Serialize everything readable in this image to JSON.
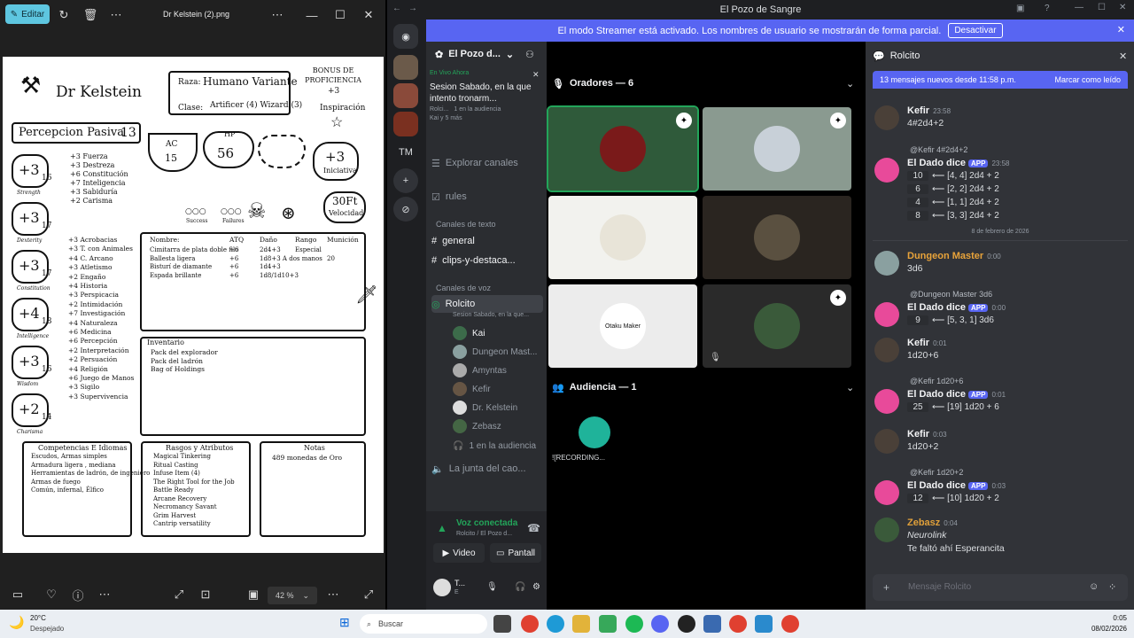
{
  "photos": {
    "edit_label": "Editar",
    "filename": "Dr Kelstein (2).png",
    "zoom": "42 %"
  },
  "sheet": {
    "name": "Dr Kelstein",
    "race_label": "Raza:",
    "race": "Humano Variante",
    "class_label": "Clase:",
    "class": "Artificer (4) Wizard (3)",
    "bonus_label": "BONUS DE PROFICIENCIA",
    "bonus": "+3",
    "inspiration": "Inspiración",
    "passive_label": "Percepcion Pasiva",
    "passive": "13",
    "ac_label": "AC",
    "ac": "15",
    "hp_label": "HP",
    "hp": "56",
    "init": "+3",
    "init_label": "Iniciativa",
    "speed": "30Ft",
    "speed_label": "Velocidad",
    "success": "Success",
    "failures": "Failures",
    "abilities": [
      {
        "mod": "+3",
        "score": "16",
        "name": "Strength"
      },
      {
        "mod": "+3",
        "score": "17",
        "name": "Dexterity"
      },
      {
        "mod": "+3",
        "score": "17",
        "name": "Constitution"
      },
      {
        "mod": "+4",
        "score": "18",
        "name": "Intelligence"
      },
      {
        "mod": "+3",
        "score": "16",
        "name": "Wisdom"
      },
      {
        "mod": "+2",
        "score": "14",
        "name": "Charisma"
      }
    ],
    "saves": [
      "+3 Fuerza",
      "+3 Destreza",
      "+6 Constitución",
      "+7 Inteligencia",
      "+3 Sabiduría",
      "+2 Carisma"
    ],
    "skills": [
      "+3 Acrobacias",
      "+3 T. con Animales",
      "+4 C. Arcano",
      "+3 Atletismo",
      "+2 Engaño",
      "+4 Historia",
      "+3 Perspicacia",
      "+2 Intimidación",
      "+7 Investigación",
      "+4 Naturaleza",
      "+6 Medicina",
      "+6 Percepción",
      "+2 Interpretación",
      "+2 Persuación",
      "+4 Religión",
      "+6 Juego de Manos",
      "+3 Sigilo",
      "+3 Supervivencia"
    ],
    "attack_headers": [
      "Nombre:",
      "ATQ",
      "Daño",
      "Rango",
      "Munición"
    ],
    "attacks": [
      [
        "Cimitarra de plata doble filo",
        "+6",
        "2d4+3",
        "Especial",
        ""
      ],
      [
        "Ballesta ligera",
        "+6",
        "1d8+3 A dos manos",
        "",
        "20"
      ],
      [
        "Bisturí de diamante",
        "+6",
        "1d4+3",
        "",
        ""
      ],
      [
        "Espada brillante",
        "+6",
        "1d8/1d10+3",
        "",
        ""
      ]
    ],
    "inventory_label": "Inventario",
    "inventory": [
      "Pack del explorador",
      "Pack del ladrón",
      "Bag of Holdings"
    ],
    "prof_title": "Competencias E Idiomas",
    "prof": [
      "Escudos, Armas simples",
      "Armadura ligera , mediana",
      "Herramientas de ladrón, de ingeniero",
      "Armas de fuego",
      "Común, infernal, Élfico"
    ],
    "traits_title": "Rasgos y Atributos",
    "traits": [
      "Magical Tinkering",
      "Ritual Casting",
      "Infuse Item (4)",
      "The Right Tool for the Job",
      "Battle Ready",
      "Arcane Recovery",
      "Necromancy Savant",
      "Grim Harvest",
      "Cantrip versatility"
    ],
    "notes_title": "Notas",
    "notes": [
      "489 monedas de Oro"
    ]
  },
  "discord": {
    "title": "El Pozo de Sangre",
    "banner": "El modo Streamer está activado. Los nombres de usuario se mostrarán de forma parcial.",
    "banner_btn": "Desactivar",
    "guild_initials": "TM",
    "server": "El Pozo d...",
    "live_label": "En Vivo Ahora",
    "live_title": "Sesion Sabado, en la que intento tronarm...",
    "live_host": "Rolci...",
    "live_aud": "1 en la audiencia",
    "live_people": "Kai y 5 más",
    "explore": "Explorar canales",
    "rules": "rules",
    "text_cat": "Canales de texto",
    "text_channels": [
      "general",
      "clips-y-destaca..."
    ],
    "voice_cat": "Canales de voz",
    "voice_channel": "Rolcito",
    "voice_sub": "Sesion Sabado, en la que...",
    "voice_users": [
      "Kai",
      "Dungeon Mast...",
      "Amyntas",
      "Kefir",
      "Dr. Kelstein",
      "Zebasz"
    ],
    "voice_aud": "1 en la audiencia",
    "other_channel": "La junta del cao...",
    "conn_label": "Voz conectada",
    "conn_sub": "Rolcito / El Pozo d...",
    "video": "Video",
    "screen": "Pantall",
    "user_short": "T...",
    "user_sub": "E",
    "speakers": "Oradores — 6",
    "audience": "Audiencia — 1",
    "recording": "![RECORDING...",
    "tile_text": "Otaku Maker",
    "chat_title": "Rolcito",
    "new_msgs": "13 mensajes nuevos desde 11:58 p.m.",
    "mark_read": "Marcar como leído",
    "date_sep": "8 de febrero de 2026",
    "input_ph": "Mensaje Rolcito",
    "app_tag": "APP",
    "messages": [
      {
        "user": "Kefir",
        "time": "23:58",
        "text": "4#2d4+2"
      },
      {
        "reply": "@Kefir 4#2d4+2",
        "user": "El Dado dice",
        "time": "23:58",
        "dice": [
          [
            "10",
            "⟵ [4, 4] 2d4 + 2"
          ],
          [
            "6",
            "⟵ [2, 2] 2d4 + 2"
          ],
          [
            "4",
            "⟵ [1, 1] 2d4 + 2"
          ],
          [
            "8",
            "⟵ [3, 3] 2d4 + 2"
          ]
        ]
      },
      {
        "user": "Dungeon Master",
        "time": "0:00",
        "text": "3d6"
      },
      {
        "reply": "@Dungeon Master 3d6",
        "user": "El Dado dice",
        "time": "0:00",
        "dice": [
          [
            "9",
            "⟵ [5, 3, 1] 3d6"
          ]
        ]
      },
      {
        "user": "Kefir",
        "time": "0:01",
        "text": "1d20+6"
      },
      {
        "reply": "@Kefir 1d20+6",
        "user": "El Dado dice",
        "time": "0:01",
        "dice": [
          [
            "25",
            "⟵ [19] 1d20 + 6"
          ]
        ]
      },
      {
        "user": "Kefir",
        "time": "0:03",
        "text": "1d20+2"
      },
      {
        "reply": "@Kefir 1d20+2",
        "user": "El Dado dice",
        "time": "0:03",
        "dice": [
          [
            "12",
            "⟵ [10] 1d20 + 2"
          ]
        ]
      },
      {
        "user": "Zebasz",
        "time": "0:04",
        "text": "Neurolink",
        "text2": "Te faltó ahí Esperancita"
      }
    ]
  },
  "taskbar": {
    "temp": "20°C",
    "weather": "Despejado",
    "search": "Buscar",
    "time": "0:05",
    "date": "08/02/2026"
  },
  "colors": {
    "accent": "#5865f2",
    "dm": "#e8a33a",
    "zebasz": "#e0a03a",
    "speaking": "#23a55a"
  }
}
